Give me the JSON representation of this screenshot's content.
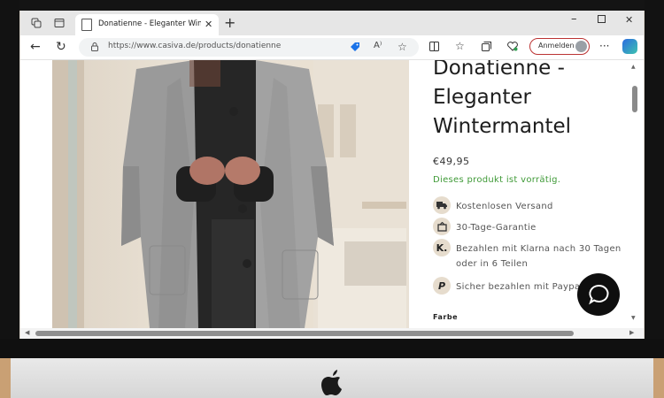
{
  "browser": {
    "tab_title": "Donatienne - Eleganter Wintermantel",
    "url": "https://www.casiva.de/products/donatienne",
    "signin_label": "Anmelden",
    "accent_color": "#c0392b"
  },
  "product": {
    "title_lines": [
      "Donatienne -",
      "Eleganter",
      "Wintermantel"
    ],
    "price": "€49,95",
    "stock_status": "Dieses produkt ist vorrätig.",
    "stock_color": "#3f9a37",
    "features": [
      {
        "icon": "truck-icon",
        "glyph": "🚚",
        "text": "Kostenlosen Versand"
      },
      {
        "icon": "return-box-icon",
        "glyph": "↺",
        "text": "30-Tage-Garantie"
      },
      {
        "icon": "klarna-icon",
        "glyph": "K.",
        "text": "Bezahlen mit Klarna nach 30 Tagen oder in 6 Teilen"
      },
      {
        "icon": "paypal-icon",
        "glyph": "P",
        "text": "Sicher bezahlen mit Paypal"
      }
    ],
    "color_label": "Farbe"
  }
}
